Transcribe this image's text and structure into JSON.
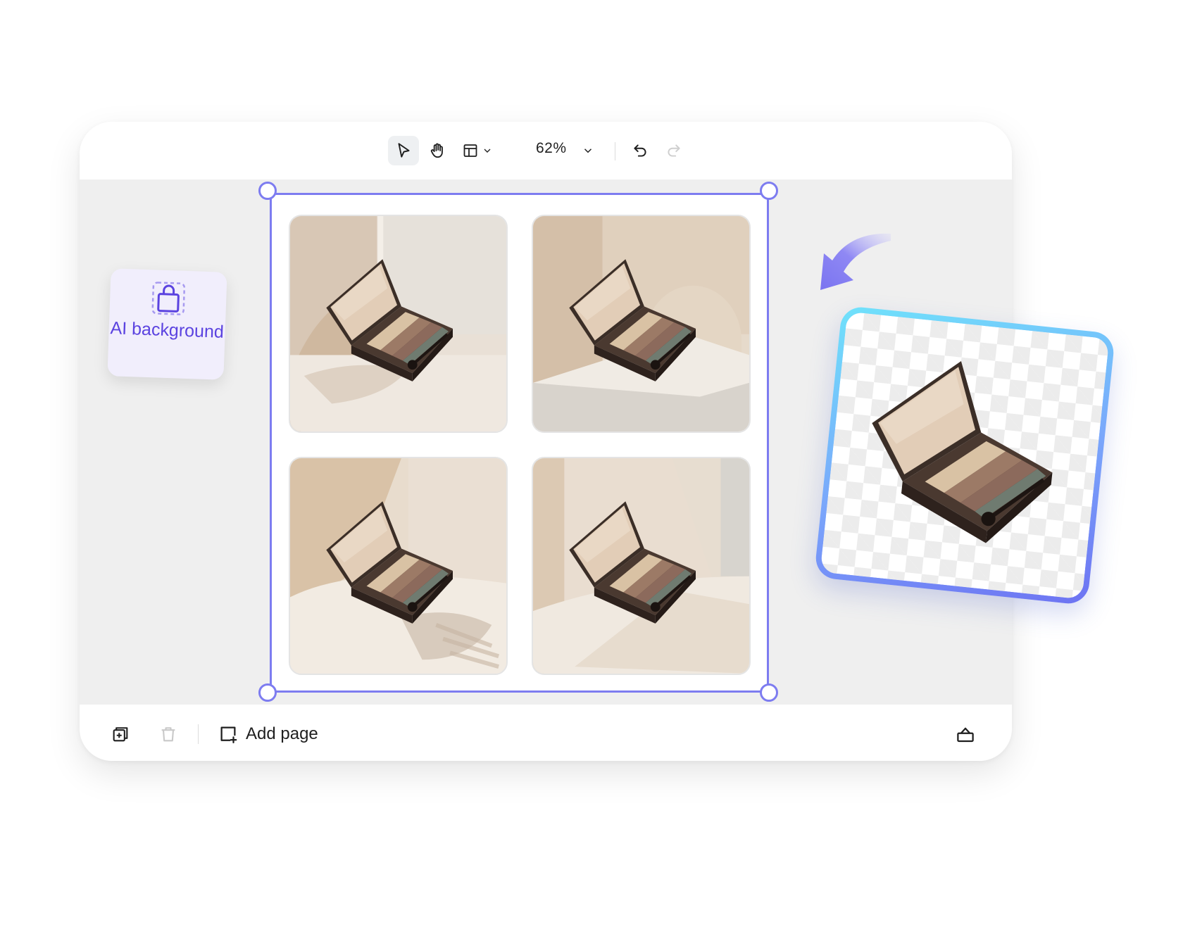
{
  "toolbar": {
    "select_tool_icon": "cursor-arrow-icon",
    "hand_tool_icon": "hand-icon",
    "layout_icon": "layout-icon",
    "zoom_value": "62%",
    "undo_icon": "undo-icon",
    "redo_icon": "redo-icon"
  },
  "ai_card": {
    "icon": "shopping-bag-icon",
    "label": "AI background"
  },
  "canvas": {
    "selection_color": "#7d7cf0",
    "thumbnails": [
      {
        "name": "generated-background-1"
      },
      {
        "name": "generated-background-2"
      },
      {
        "name": "generated-background-3"
      },
      {
        "name": "generated-background-4"
      }
    ]
  },
  "cutout": {
    "name": "transparent-product-cutout",
    "border_colors": [
      "#6fe2fb",
      "#6d73f2"
    ]
  },
  "bottom_bar": {
    "duplicate_icon": "duplicate-page-icon",
    "delete_icon": "trash-icon",
    "add_page_label": "Add page",
    "collapse_icon": "collapse-panel-icon"
  },
  "colors": {
    "accent": "#7d7cf0",
    "ai_text": "#5b43e0",
    "canvas_bg": "#efefef"
  }
}
